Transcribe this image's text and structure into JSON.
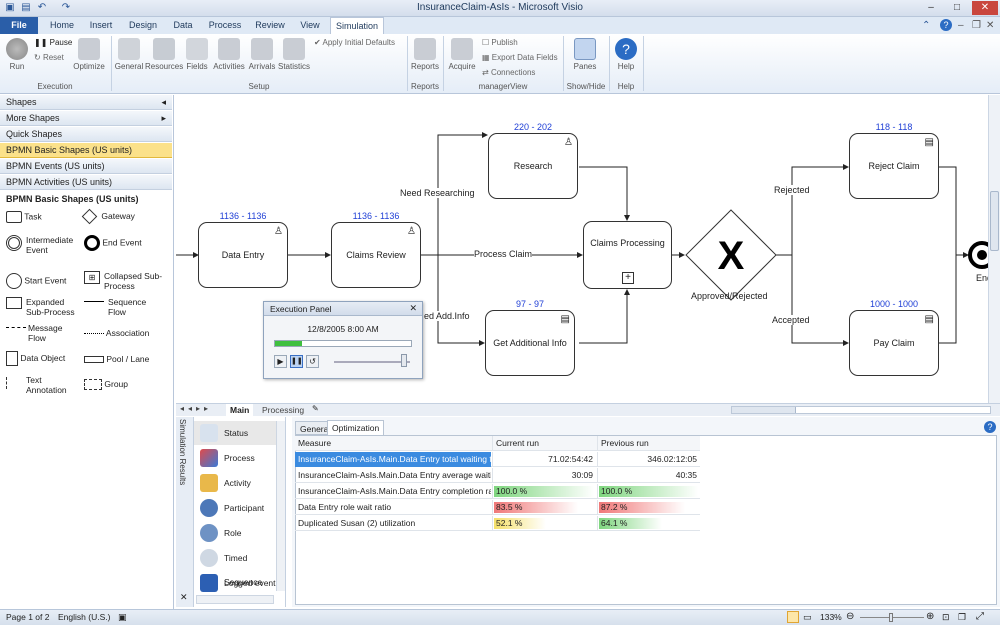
{
  "window": {
    "title": "InsuranceClaim-AsIs - Microsoft Visio"
  },
  "tabs": [
    "File",
    "Home",
    "Insert",
    "Design",
    "Data",
    "Process",
    "Review",
    "View",
    "Simulation"
  ],
  "ribbon": {
    "execution": {
      "run": "Run",
      "pause": "Pause",
      "reset": "Reset",
      "optimize": "Optimize",
      "group": "Execution"
    },
    "setup": {
      "general": "General",
      "resources": "Resources",
      "fields": "Fields",
      "activities": "Activities",
      "arrivals": "Arrivals",
      "statistics": "Statistics",
      "apply_defaults": "Apply Initial Defaults",
      "group": "Setup"
    },
    "reports": {
      "reports": "Reports",
      "group": "Reports"
    },
    "manager": {
      "acquire": "Acquire",
      "publish": "Publish",
      "export": "Export Data Fields",
      "connections": "Connections",
      "group": "managerView"
    },
    "showhide": {
      "panes": "Panes",
      "group": "Show/Hide"
    },
    "help": {
      "help": "Help",
      "group": "Help"
    }
  },
  "shapes_pane": {
    "title": "Shapes",
    "sections": [
      "More Shapes",
      "Quick Shapes",
      "BPMN Basic Shapes (US units)",
      "BPMN Events (US units)",
      "BPMN Activities (US units)"
    ],
    "stencil_title": "BPMN Basic Shapes (US units)",
    "items": [
      "Task",
      "Gateway",
      "Intermediate Event",
      "End Event",
      "Start Event",
      "Collapsed Sub-Process",
      "Expanded Sub-Process",
      "Sequence Flow",
      "Message Flow",
      "Association",
      "Data Object",
      "Pool / Lane",
      "Text Annotation",
      "Group"
    ]
  },
  "diagram": {
    "tasks": {
      "data_entry": {
        "label": "Data Entry",
        "count": "1136 - 1136"
      },
      "claims_review": {
        "label": "Claims Review",
        "count": "1136 - 1136"
      },
      "research": {
        "label": "Research",
        "count": "220 - 202"
      },
      "get_info": {
        "label": "Get Additional Info",
        "count": "97 - 97"
      },
      "claims_processing": {
        "label": "Claims Processing"
      },
      "reject": {
        "label": "Reject Claim",
        "count": "118 - 118"
      },
      "pay": {
        "label": "Pay Claim",
        "count": "1000 - 1000"
      }
    },
    "gateway_label": "Approved/Rejected",
    "edges": {
      "need_research": "Need Researching",
      "process_claim": "Process Claim",
      "need_info": "ed Add.Info",
      "rejected": "Rejected",
      "accepted": "Accepted"
    },
    "end_label": "End"
  },
  "exec_panel": {
    "title": "Execution Panel",
    "datetime": "12/8/2005 8:00 AM",
    "progress": 0.2
  },
  "page_tabs": [
    "Main",
    "Processing"
  ],
  "sim_results": {
    "title": "Simulation Results",
    "items": [
      "Status",
      "Process",
      "Activity",
      "Participant",
      "Role",
      "Timed Sequence",
      "Logged event"
    ],
    "tabs": [
      "General",
      "Optimization"
    ],
    "columns": [
      "Measure",
      "Current run",
      "Previous run"
    ],
    "rows": [
      {
        "measure": "InsuranceClaim-AsIs.Main.Data Entry total waiting time",
        "current": "71.02:54:42",
        "previous": "346.02:12:05"
      },
      {
        "measure": "InsuranceClaim-AsIs.Main.Data Entry average waiting time",
        "current": "30:09",
        "previous": "40:35"
      },
      {
        "measure": "InsuranceClaim-AsIs.Main.Data Entry completion ratio",
        "current": "100.0 %",
        "previous": "100.0 %",
        "current_fill": 1.0,
        "previous_fill": 1.0,
        "current_color": "#7fd67f",
        "previous_color": "#7fd67f"
      },
      {
        "measure": "Data Entry role wait ratio",
        "current": "83.5 %",
        "previous": "87.2 %",
        "current_fill": 0.835,
        "previous_fill": 0.872,
        "current_color": "#f07878",
        "previous_color": "#f07878"
      },
      {
        "measure": "Duplicated Susan (2) utilization",
        "current": "52.1 %",
        "previous": "64.1 %",
        "current_fill": 0.521,
        "previous_fill": 0.641,
        "current_color": "#f5e06a",
        "previous_color": "#7fd67f"
      }
    ]
  },
  "status": {
    "page": "Page 1 of 2",
    "language": "English (U.S.)",
    "zoom": "133%"
  }
}
